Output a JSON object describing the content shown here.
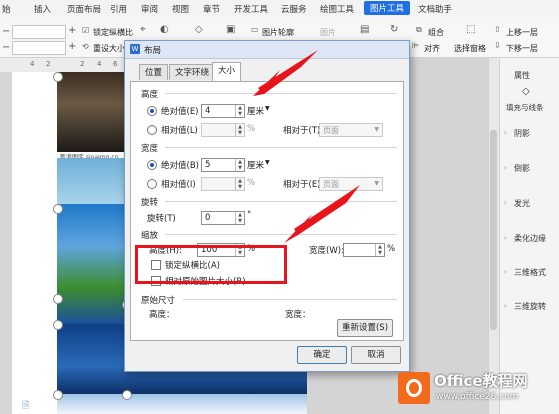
{
  "ribbon": {
    "tabs": [
      "始",
      "插入",
      "页面布局",
      "引用",
      "审阅",
      "视图",
      "章节",
      "开发工具",
      "云服务",
      "绘图工具",
      "图片工具",
      "文档助手"
    ],
    "active_tab": "图片工具"
  },
  "toolbar": {
    "lock_ratio": "锁定纵横比",
    "reset_size": "重设大小",
    "picture_outline": "图片轮廓",
    "picture_effect": "图片",
    "group": "组合",
    "move_up": "上移一层",
    "align": "对齐",
    "selection_pane": "选择窗格",
    "move_down": "下移一层"
  },
  "ruler": {
    "numbers": [
      "4",
      "2",
      "",
      "2",
      "4",
      "6",
      "8"
    ]
  },
  "right_panel": {
    "header": "属性",
    "fill_label": "填充与线条",
    "items": [
      "阴影",
      "倒影",
      "发光",
      "柔化边缘",
      "三维格式",
      "三维旋转"
    ]
  },
  "doc": {
    "watermark_text": "新浪图库 sinaimg.cn"
  },
  "dialog": {
    "title": "布局",
    "tabs": [
      "位置",
      "文字环绕",
      "大小"
    ],
    "selected_tab": "大小",
    "height": {
      "title": "高度",
      "absolute_label": "绝对值(E)",
      "absolute_value": "4",
      "unit": "厘米",
      "relative_label": "相对值(L)",
      "percent": "%",
      "relative_to_label": "相对于(T)",
      "relative_to_value": "页面"
    },
    "width": {
      "title": "宽度",
      "absolute_label": "绝对值(B)",
      "absolute_value": "5",
      "unit": "厘米",
      "relative_label": "相对值(I)",
      "percent": "%",
      "relative_to_label": "相对于(E)",
      "relative_to_value": "页面"
    },
    "rotate": {
      "title": "旋转",
      "label": "旋转(T)",
      "value": "0",
      "unit": "°"
    },
    "scale": {
      "title": "缩放",
      "height_label": "高度(H):",
      "height_value": "100",
      "width_label": "宽度(W):",
      "width_value": "",
      "percent": "%",
      "lock_ratio": "锁定纵横比(A)",
      "relative_original": "相对原始图片大小(R)"
    },
    "original": {
      "title": "原始尺寸",
      "height_label": "高度：",
      "width_label": "宽度："
    },
    "reset_button": "重新设置(S)",
    "ok_button": "确定",
    "cancel_button": "取消"
  },
  "watermark": {
    "brand": "Office教程网",
    "url": "www.office26.com"
  },
  "colors": {
    "accent": "#1f6fe0",
    "highlight": "#e8141b",
    "brand_orange": "#f26a1b"
  }
}
